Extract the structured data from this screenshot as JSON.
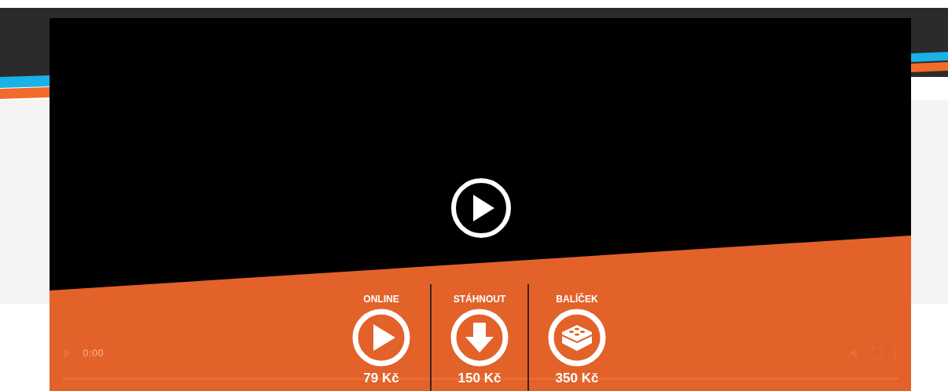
{
  "player": {
    "time": "0:00"
  },
  "options": [
    {
      "label": "ONLINE",
      "price": "79 Kč",
      "kind": "play"
    },
    {
      "label": "STÁHNOUT",
      "price": "150 Kč",
      "kind": "download"
    },
    {
      "label": "BALÍČEK",
      "price": "350 Kč",
      "kind": "package"
    }
  ]
}
